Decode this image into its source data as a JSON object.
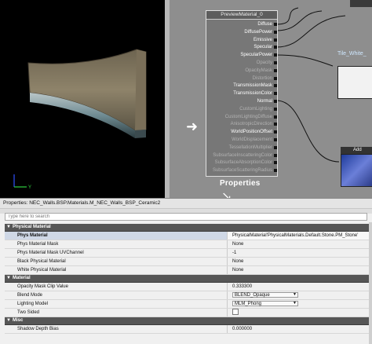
{
  "graph": {
    "node_title": "PreviewMaterial_0",
    "pins": [
      {
        "label": "Diffuse",
        "active": true
      },
      {
        "label": "DiffusePower",
        "active": true
      },
      {
        "label": "Emissive",
        "active": true
      },
      {
        "label": "Specular",
        "active": true
      },
      {
        "label": "SpecularPower",
        "active": true
      },
      {
        "label": "Opacity",
        "active": false
      },
      {
        "label": "OpacityMask",
        "active": false
      },
      {
        "label": "Distortion",
        "active": false
      },
      {
        "label": "TransmissionMask",
        "active": true
      },
      {
        "label": "TransmissionColor",
        "active": true
      },
      {
        "label": "Normal",
        "active": true
      },
      {
        "label": "CustomLighting",
        "active": false
      },
      {
        "label": "CustomLightingDiffuse",
        "active": false
      },
      {
        "label": "AnisotropicDirection",
        "active": false
      },
      {
        "label": "WorldPositionOffset",
        "active": true
      },
      {
        "label": "WorldDisplacement",
        "active": false
      },
      {
        "label": "TessellationMultiplier",
        "active": false
      },
      {
        "label": "SubsurfaceInscatteringColor",
        "active": false
      },
      {
        "label": "SubsurfaceAbsorptionColor",
        "active": false
      },
      {
        "label": "SubsurfaceScatteringRadius",
        "active": false
      }
    ],
    "tile_node_label": "Tile_White_",
    "add_node_label": "Add",
    "annotation_label": "Properties",
    "arrow_right": "➜",
    "arrow_down": "↘"
  },
  "properties": {
    "title": "Properties: NEC_Walls.BSP.Materials.M_NEC_Walls_BSP_Ceramic2",
    "search_placeholder": "Type here to search",
    "categories": [
      {
        "label": "Physical Material",
        "rows": [
          {
            "name": "Phys Material",
            "value": "PhysicalMaterial'PhysicalMaterials.Default.Stone.PM_Stone'",
            "kind": "text",
            "selected": true
          },
          {
            "name": "Phys Material Mask",
            "value": "None",
            "kind": "text"
          },
          {
            "name": "Phys Material Mask UVChannel",
            "value": "-1",
            "kind": "text"
          },
          {
            "name": "Black Physical Material",
            "value": "None",
            "kind": "text"
          },
          {
            "name": "White Physical Material",
            "value": "None",
            "kind": "text"
          }
        ]
      },
      {
        "label": "Material",
        "rows": [
          {
            "name": "Opacity Mask Clip Value",
            "value": "0.333300",
            "kind": "text"
          },
          {
            "name": "Blend Mode",
            "value": "BLEND_Opaque",
            "kind": "combo"
          },
          {
            "name": "Lighting Model",
            "value": "MLM_Phong",
            "kind": "combo"
          },
          {
            "name": "Two Sided",
            "value": "",
            "kind": "checkbox"
          }
        ]
      },
      {
        "label": "Misc",
        "rows": [
          {
            "name": "Shadow Depth Bias",
            "value": "0.000000",
            "kind": "text"
          }
        ]
      }
    ]
  },
  "colors": {
    "graph_bg": "#8e8e8e",
    "category_bg": "#565656",
    "selected_row": "#cfd8e6"
  }
}
